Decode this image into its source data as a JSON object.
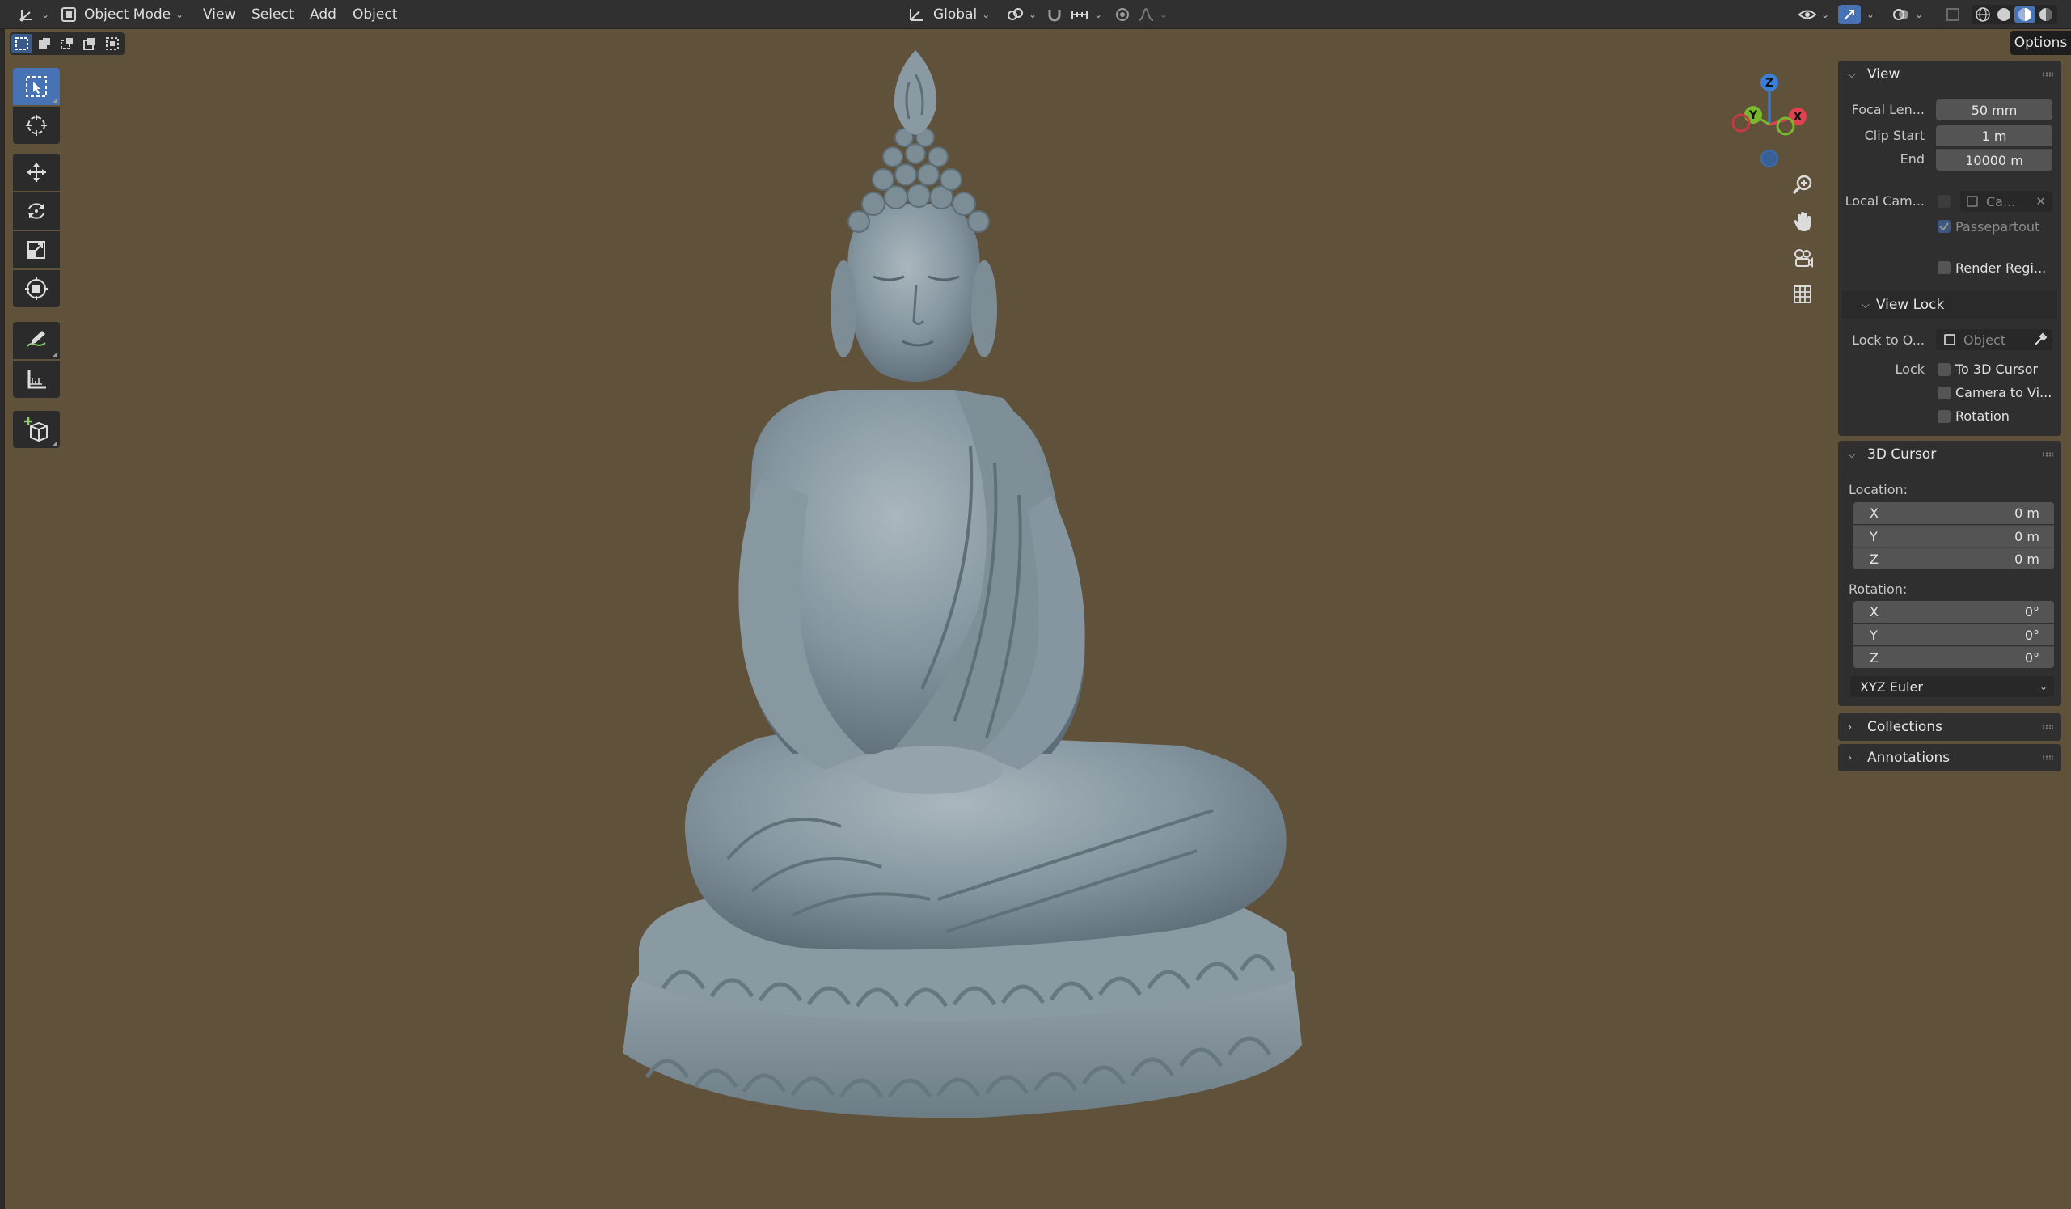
{
  "header": {
    "mode": "Object Mode",
    "menus": [
      "View",
      "Select",
      "Add",
      "Object"
    ],
    "orientation": "Global"
  },
  "sidebar": {
    "options_label": "Options",
    "view_panel": {
      "title": "View",
      "focal_length_label": "Focal Len...",
      "focal_length_value": "50 mm",
      "clip_start_label": "Clip Start",
      "clip_start_value": "1 m",
      "end_label": "End",
      "end_value": "10000 m",
      "local_camera_label": "Local Cam...",
      "local_camera_value": "Ca...",
      "passepartout_label": "Passepartout",
      "render_region_label": "Render Regi..."
    },
    "view_lock": {
      "title": "View Lock",
      "lock_to_object_label": "Lock to O...",
      "lock_to_object_placeholder": "Object",
      "lock_label": "Lock",
      "to_3d_cursor_label": "To 3D Cursor",
      "camera_to_view_label": "Camera to Vi...",
      "rotation_label": "Rotation"
    },
    "cursor_panel": {
      "title": "3D Cursor",
      "location_label": "Location:",
      "location": [
        {
          "axis": "X",
          "value": "0 m"
        },
        {
          "axis": "Y",
          "value": "0 m"
        },
        {
          "axis": "Z",
          "value": "0 m"
        }
      ],
      "rotation_label": "Rotation:",
      "rotation": [
        {
          "axis": "X",
          "value": "0°"
        },
        {
          "axis": "Y",
          "value": "0°"
        },
        {
          "axis": "Z",
          "value": "0°"
        }
      ],
      "rotation_mode": "XYZ Euler"
    },
    "collections_title": "Collections",
    "annotations_title": "Annotations"
  },
  "gizmo": {
    "x": "X",
    "y": "Y",
    "z": "Z"
  },
  "colors": {
    "header_bg": "#303030",
    "viewport_bg": "#5f513a",
    "accent": "#4772b3",
    "axis_x": "#e0434f",
    "axis_y": "#78b82a",
    "axis_z": "#3d7fd6"
  }
}
